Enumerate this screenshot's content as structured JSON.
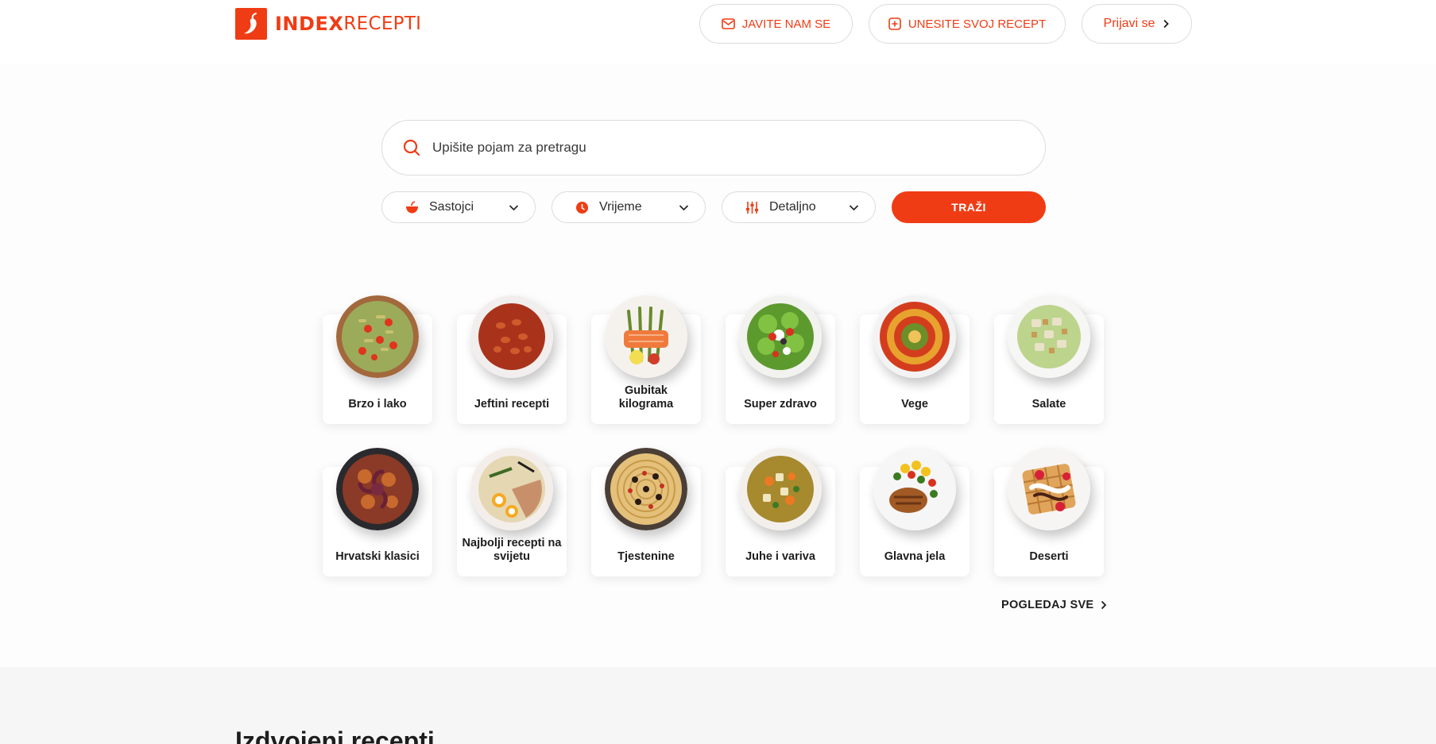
{
  "header": {
    "logo_bold": "INDEX",
    "logo_light": "RECEPTI",
    "contact_label": "JAVITE NAM SE",
    "submit_label": "UNESITE SVOJ RECEPT",
    "login_label": "Prijavi se"
  },
  "search": {
    "placeholder": "Upišite pojam za pretragu",
    "filters": {
      "ingredients": "Sastojci",
      "time": "Vrijeme",
      "detail": "Detaljno"
    },
    "button_label": "TRAŽI"
  },
  "categories": [
    {
      "label": "Brzo i lako",
      "icon": "pasta-salad-plate"
    },
    {
      "label": "Jeftini recepti",
      "icon": "bean-stew-plate"
    },
    {
      "label": "Gubitak kilograma",
      "icon": "salmon-asparagus-plate"
    },
    {
      "label": "Super zdravo",
      "icon": "green-salad-plate"
    },
    {
      "label": "Vege",
      "icon": "ratatouille-plate"
    },
    {
      "label": "Salate",
      "icon": "caesar-salad-plate"
    },
    {
      "label": "Hrvatski klasici",
      "icon": "octopus-peka-plate"
    },
    {
      "label": "Najbolji recepti na svijetu",
      "icon": "ramen-bowl-plate"
    },
    {
      "label": "Tjestenine",
      "icon": "spaghetti-plate"
    },
    {
      "label": "Juhe i variva",
      "icon": "soup-bowl-plate"
    },
    {
      "label": "Glavna jela",
      "icon": "chicken-main-plate"
    },
    {
      "label": "Deserti",
      "icon": "waffle-dessert-plate"
    }
  ],
  "view_all_label": "POGLEDAJ SVE",
  "featured": {
    "title": "Izdvojeni recepti"
  },
  "colors": {
    "accent": "#f03c14",
    "text": "#1d1d1d",
    "border": "#dcdcdc",
    "section_bg": "#f6f6f6"
  }
}
